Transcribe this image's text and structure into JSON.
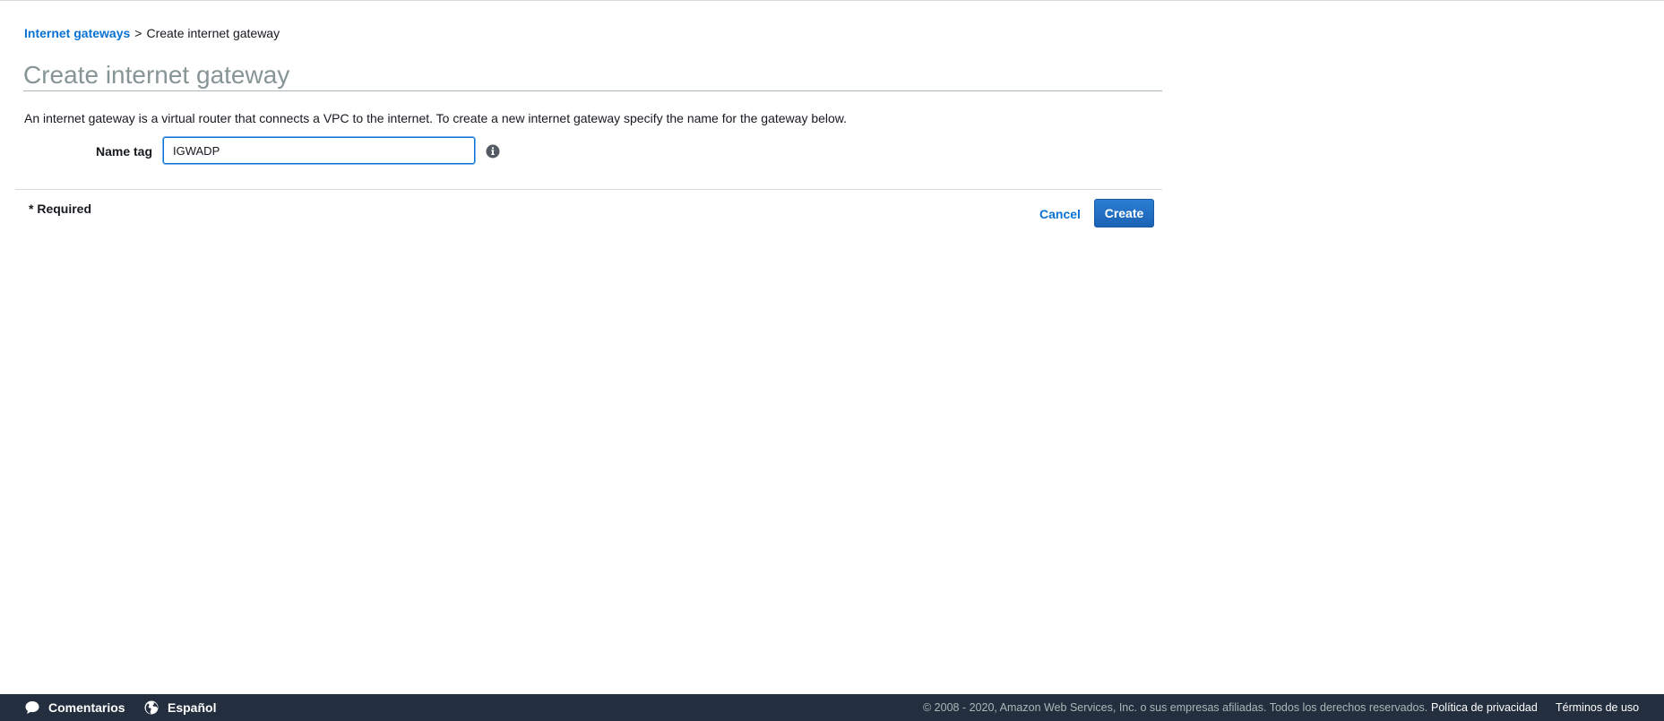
{
  "breadcrumb": {
    "parent_label": "Internet gateways",
    "separator": ">",
    "current_label": "Create internet gateway"
  },
  "page": {
    "title": "Create internet gateway",
    "description": "An internet gateway is a virtual router that connects a VPC to the internet. To create a new internet gateway specify the name for the gateway below."
  },
  "form": {
    "name_tag_label": "Name tag",
    "name_tag_value": "IGWADP",
    "info_icon": "info-icon",
    "required_note": "* Required",
    "cancel_label": "Cancel",
    "create_label": "Create"
  },
  "footer": {
    "feedback_label": "Comentarios",
    "feedback_icon": "speech-bubble-icon",
    "language_label": "Español",
    "language_icon": "globe-icon",
    "copyright": "© 2008 - 2020, Amazon Web Services, Inc. o sus empresas afiliadas. Todos los derechos reservados.",
    "privacy_label": "Política de privacidad",
    "terms_label": "Términos de uso"
  },
  "colors": {
    "link": "#0972d3",
    "primary_button": "#1b62b5",
    "footer_bg": "#232f3e",
    "title_gray": "#879596"
  }
}
